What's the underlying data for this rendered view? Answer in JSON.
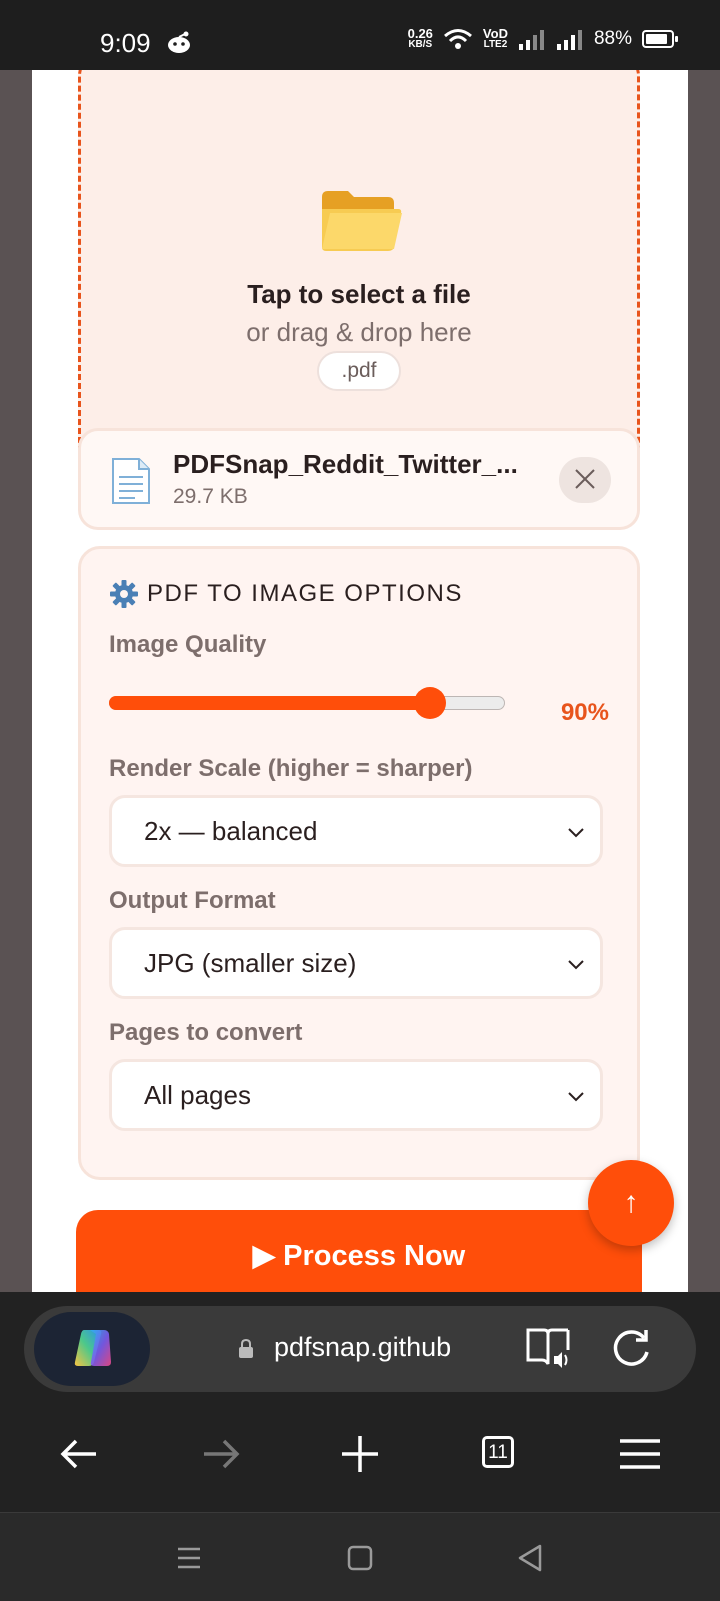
{
  "status_bar": {
    "time": "9:09",
    "net_speed_value": "0.26",
    "net_speed_unit": "KB/S",
    "network_label_top": "VoD",
    "network_label_bottom": "LTE2",
    "battery_percent": "88%",
    "battery_level": 0.88
  },
  "dropzone": {
    "icon": "folder-icon",
    "title": "Tap to select a file",
    "subtitle": "or drag & drop here",
    "accepted_type": ".pdf"
  },
  "file": {
    "icon": "document-icon",
    "name": "PDFSnap_Reddit_Twitter_...",
    "size": "29.7 KB"
  },
  "options": {
    "title": "PDF TO IMAGE OPTIONS",
    "image_quality": {
      "label": "Image Quality",
      "value": 90,
      "display": "90%"
    },
    "render_scale": {
      "label": "Render Scale (higher = sharper)",
      "selected": "2x — balanced"
    },
    "output_format": {
      "label": "Output Format",
      "selected": "JPG (smaller size)"
    },
    "pages": {
      "label": "Pages to convert",
      "selected": "All pages"
    }
  },
  "process_button": {
    "label": "▶ Process Now"
  },
  "scroll_top_button": {
    "label": "↑"
  },
  "browser": {
    "url": "pdfsnap.github",
    "tab_count": "11"
  },
  "colors": {
    "accent": "#ff4e0a",
    "dropzone_bg": "#fdeee8",
    "dashed_border": "#e8541c",
    "browser_bg": "#222222"
  }
}
